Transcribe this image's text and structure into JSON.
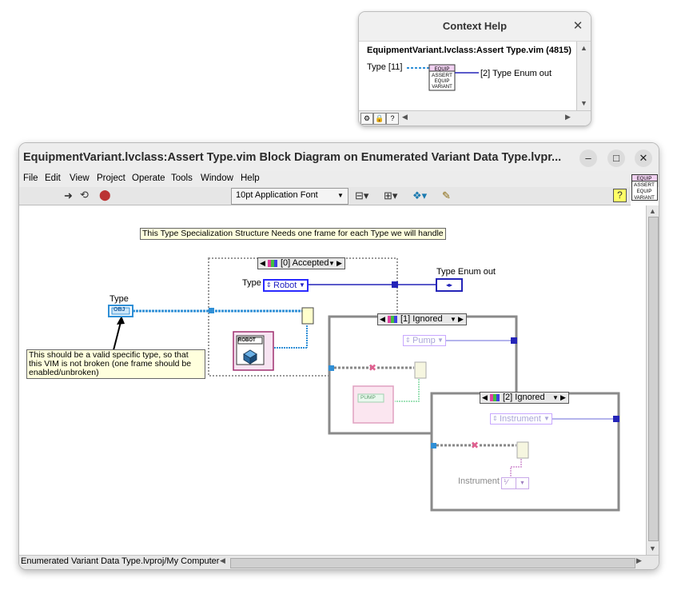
{
  "context_help": {
    "title": "Context Help",
    "vi_name": "EquipmentVariant.lvclass:Assert Type.vim (4815)",
    "input_label": "Type [11]",
    "output_label": "[2] Type Enum out",
    "icon_lines": [
      "EQUIP",
      "ASSERT",
      "EQUIP",
      "VARIANT"
    ]
  },
  "window": {
    "title": "EquipmentVariant.lvclass:Assert Type.vim Block Diagram on Enumerated Variant Data Type.lvpr...",
    "menu": [
      "File",
      "Edit",
      "View",
      "Project",
      "Operate",
      "Tools",
      "Window",
      "Help"
    ],
    "font_select": "10pt Application Font",
    "status_path": "Enumerated Variant Data Type.lvproj/My Computer",
    "vi_icon_lines": [
      "EQUIP",
      "ASSERT",
      "EQUIP",
      "VARIANT"
    ]
  },
  "diagram": {
    "header_note": "This Type Specialization Structure Needs one frame for each Type we will handle",
    "type_label": "Type",
    "type_terminal": "OBJ",
    "comment_note": "This should be a valid specific type, so that this VIM is not broken (one frame should be enabled/unbroken)",
    "frame0": {
      "selector": "[0] Accepted",
      "enum_label": "Type",
      "enum_value": "Robot",
      "class_icon": "ROBOT"
    },
    "out_terminal_label": "Type Enum out",
    "frame1": {
      "selector": "[1] Ignored",
      "enum_value": "Pump",
      "class_icon": "PUMP"
    },
    "frame2": {
      "selector": "[2] Ignored",
      "enum_value": "Instrument",
      "constant_label": "Instrument"
    }
  },
  "colors": {
    "wire_class": "#2f8fd6",
    "wire_enum": "#2424b8",
    "frame_gray": "#8a8a8a",
    "note_bg": "#ffffdd"
  }
}
